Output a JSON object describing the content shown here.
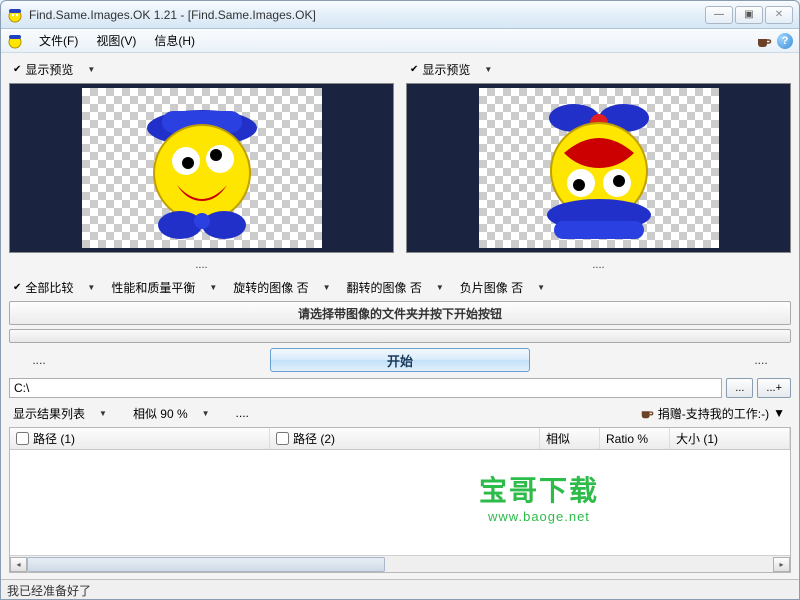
{
  "window": {
    "title": "Find.Same.Images.OK 1.21 - [Find.Same.Images.OK]",
    "buttons": {
      "minimize": "—",
      "maximize": "▣",
      "close": "✕"
    }
  },
  "menubar": {
    "file": "文件(F)",
    "view": "视图(V)",
    "info": "信息(H)"
  },
  "preview": {
    "left_label": "显示预览",
    "right_label": "显示预览",
    "left_filename": "....",
    "right_filename": "...."
  },
  "options": {
    "compare_all": "全部比较",
    "perf_quality": "性能和质量平衡",
    "rotated": "旋转的图像 否",
    "flipped": "翻转的图像 否",
    "negative": "负片图像 否"
  },
  "instruction": "请选择带图像的文件夹并按下开始按钮",
  "start": {
    "left_dots": "....",
    "button": "开始",
    "right_dots": "...."
  },
  "path": {
    "value": "C:\\",
    "browse": "...",
    "browse_add": "...+"
  },
  "results": {
    "list_label": "显示结果列表",
    "similarity": "相似 90 %",
    "dots": "....",
    "donate": "捐赠-支持我的工作:-)"
  },
  "table": {
    "col_path1": "路径 (1)",
    "col_path2": "路径 (2)",
    "col_similar": "相似",
    "col_ratio": "Ratio %",
    "col_size1": "大小 (1)"
  },
  "statusbar": "我已经准备好了",
  "watermark": {
    "big": "宝哥下载",
    "small": "www.baoge.net"
  }
}
